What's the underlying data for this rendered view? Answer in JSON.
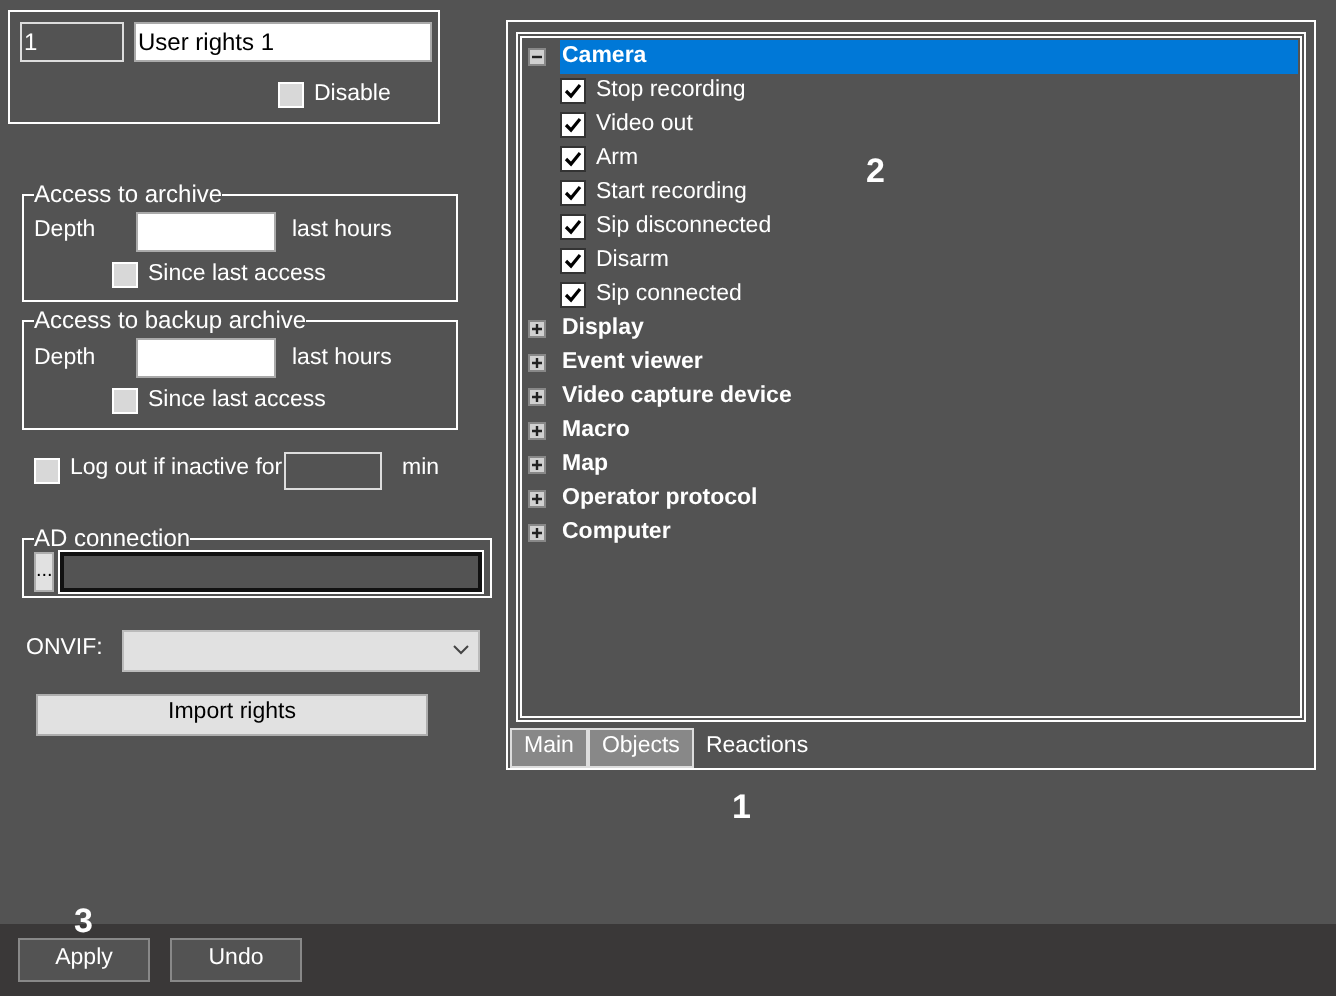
{
  "identity": {
    "number": "1",
    "name": "User rights 1",
    "disable": {
      "label": "Disable",
      "checked": false
    }
  },
  "archive_groups": [
    {
      "title": "Access to archive",
      "depth_label": "Depth",
      "unit": "last hours",
      "since": {
        "label": "Since last access",
        "checked": false
      }
    },
    {
      "title": "Access to backup archive",
      "depth_label": "Depth",
      "unit": "last hours",
      "since": {
        "label": "Since last access",
        "checked": false
      }
    }
  ],
  "logout": {
    "label": "Log out if inactive for",
    "checked": false,
    "unit": "min"
  },
  "ad_connection": {
    "title": "AD connection",
    "browse_button": "..."
  },
  "onvif": {
    "label": "ONVIF:"
  },
  "import_button": "Import rights",
  "tree": [
    {
      "label": "Camera",
      "expanded": true,
      "selected": true,
      "children": [
        {
          "label": "Stop recording",
          "checked": true
        },
        {
          "label": "Video out",
          "checked": true
        },
        {
          "label": "Arm",
          "checked": true
        },
        {
          "label": "Start recording",
          "checked": true
        },
        {
          "label": "Sip disconnected",
          "checked": true
        },
        {
          "label": "Disarm",
          "checked": true
        },
        {
          "label": "Sip connected",
          "checked": true
        }
      ]
    },
    {
      "label": "Display",
      "expanded": false,
      "selected": false
    },
    {
      "label": "Event viewer",
      "expanded": false,
      "selected": false
    },
    {
      "label": "Video capture device",
      "expanded": false,
      "selected": false
    },
    {
      "label": "Macro",
      "expanded": false,
      "selected": false
    },
    {
      "label": "Map",
      "expanded": false,
      "selected": false
    },
    {
      "label": "Operator protocol",
      "expanded": false,
      "selected": false
    },
    {
      "label": "Computer",
      "expanded": false,
      "selected": false
    }
  ],
  "tabs": [
    {
      "label": "Main",
      "selected": false
    },
    {
      "label": "Objects",
      "selected": false
    },
    {
      "label": "Reactions",
      "selected": true
    }
  ],
  "callouts": {
    "tabs": "1",
    "tree": "2",
    "buttons": "3"
  },
  "buttons": [
    "Apply",
    "Undo"
  ]
}
